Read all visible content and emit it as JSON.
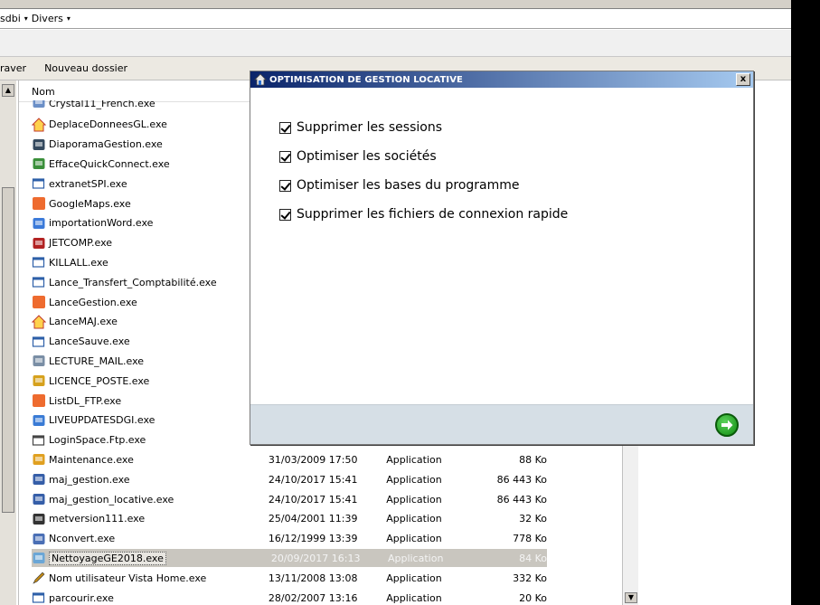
{
  "explorer": {
    "breadcrumb": [
      "sdbi",
      "Divers"
    ],
    "toolbar": [
      "raver",
      "Nouveau dossier"
    ],
    "column_name": "Nom"
  },
  "files": [
    {
      "name": "Crystal11_French.exe",
      "date": "",
      "type": "",
      "size": "",
      "icon": "setup-icon"
    },
    {
      "name": "DeplaceDonneesGL.exe",
      "date": "",
      "type": "",
      "size": "",
      "icon": "house-icon"
    },
    {
      "name": "DiaporamaGestion.exe",
      "date": "",
      "type": "",
      "size": "",
      "icon": "slideshow-icon"
    },
    {
      "name": "EffaceQuickConnect.exe",
      "date": "",
      "type": "",
      "size": "",
      "icon": "people-icon"
    },
    {
      "name": "extranetSPI.exe",
      "date": "",
      "type": "",
      "size": "",
      "icon": "app-window-icon"
    },
    {
      "name": "GoogleMaps.exe",
      "date": "",
      "type": "",
      "size": "",
      "icon": "orange-square-icon"
    },
    {
      "name": "importationWord.exe",
      "date": "",
      "type": "",
      "size": "",
      "icon": "import-icon"
    },
    {
      "name": "JETCOMP.exe",
      "date": "",
      "type": "",
      "size": "",
      "icon": "magnet-icon"
    },
    {
      "name": "KILLALL.exe",
      "date": "",
      "type": "",
      "size": "",
      "icon": "app-window-icon"
    },
    {
      "name": "Lance_Transfert_Comptabilité.exe",
      "date": "",
      "type": "",
      "size": "",
      "icon": "app-window-icon"
    },
    {
      "name": "LanceGestion.exe",
      "date": "",
      "type": "",
      "size": "",
      "icon": "orange-square-icon"
    },
    {
      "name": "LanceMAJ.exe",
      "date": "",
      "type": "",
      "size": "",
      "icon": "house-icon"
    },
    {
      "name": "LanceSauve.exe",
      "date": "",
      "type": "",
      "size": "",
      "icon": "app-window-icon"
    },
    {
      "name": "LECTURE_MAIL.exe",
      "date": "",
      "type": "",
      "size": "",
      "icon": "mail-icon"
    },
    {
      "name": "LICENCE_POSTE.exe",
      "date": "",
      "type": "",
      "size": "",
      "icon": "license-icon"
    },
    {
      "name": "ListDL_FTP.exe",
      "date": "",
      "type": "",
      "size": "",
      "icon": "orange-square-icon"
    },
    {
      "name": "LIVEUPDATESDGI.exe",
      "date": "",
      "type": "",
      "size": "",
      "icon": "update-icon"
    },
    {
      "name": "LoginSpace.Ftp.exe",
      "date": "",
      "type": "",
      "size": "",
      "icon": "window-icon"
    },
    {
      "name": "Maintenance.exe",
      "date": "31/03/2009 17:50",
      "type": "Application",
      "size": "88 Ko",
      "icon": "maintenance-icon"
    },
    {
      "name": "maj_gestion.exe",
      "date": "24/10/2017 15:41",
      "type": "Application",
      "size": "86 443 Ko",
      "icon": "computers-icon"
    },
    {
      "name": "maj_gestion_locative.exe",
      "date": "24/10/2017 15:41",
      "type": "Application",
      "size": "86 443 Ko",
      "icon": "computers-icon"
    },
    {
      "name": "metversion111.exe",
      "date": "25/04/2001 11:39",
      "type": "Application",
      "size": "32 Ko",
      "icon": "wand-icon"
    },
    {
      "name": "Nconvert.exe",
      "date": "16/12/1999 13:39",
      "type": "Application",
      "size": "778 Ko",
      "icon": "console-icon"
    },
    {
      "name": "NettoyageGE2018.exe",
      "date": "20/09/2017 16:13",
      "type": "Application",
      "size": "84 Ko",
      "icon": "cleanup-icon",
      "selected": true
    },
    {
      "name": "Nom utilisateur Vista Home.exe",
      "date": "13/11/2008 13:08",
      "type": "Application",
      "size": "332 Ko",
      "icon": "pencil-icon"
    },
    {
      "name": "parcourir.exe",
      "date": "28/02/2007 13:16",
      "type": "Application",
      "size": "20 Ko",
      "icon": "app-window-icon"
    }
  ],
  "dialog": {
    "title": "OPTIMISATION DE GESTION LOCATIVE",
    "close_label": "x",
    "options": [
      {
        "label": "Supprimer les sessions",
        "checked": true
      },
      {
        "label": "Optimiser les sociétés",
        "checked": true
      },
      {
        "label": "Optimiser les bases du programme",
        "checked": true
      },
      {
        "label": "Supprimer les fichiers de connexion rapide",
        "checked": true
      }
    ]
  },
  "colors": {
    "title_start": "#0a246a",
    "title_end": "#a6caf0",
    "footer": "#d6dfe6",
    "next_green": "#1fa21f",
    "selection": "#c9c6bf"
  }
}
